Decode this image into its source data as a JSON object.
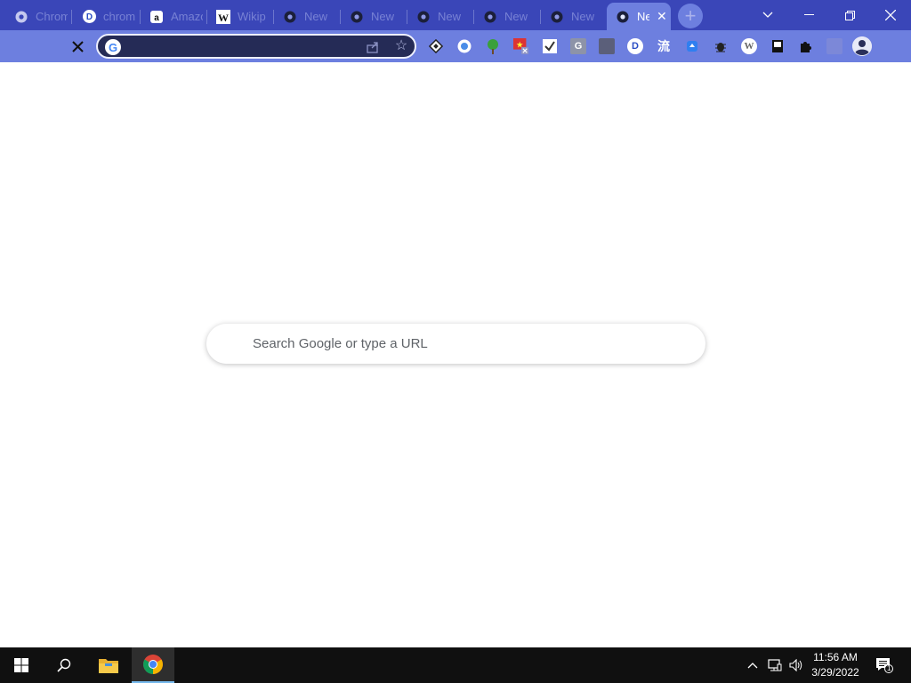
{
  "tabs": [
    {
      "title": "Chrom",
      "icon": "chrome-icon"
    },
    {
      "title": "chrom",
      "icon": "d-letter-icon"
    },
    {
      "title": "Amazo",
      "icon": "amazon-icon"
    },
    {
      "title": "Wikip",
      "icon": "wikipedia-icon"
    },
    {
      "title": "New",
      "icon": "chrome-icon"
    },
    {
      "title": "New",
      "icon": "chrome-icon"
    },
    {
      "title": "New",
      "icon": "chrome-icon"
    },
    {
      "title": "New",
      "icon": "chrome-icon"
    },
    {
      "title": "New",
      "icon": "chrome-icon"
    },
    {
      "title": "Ne",
      "icon": "chrome-icon",
      "active": true
    }
  ],
  "window_controls": {
    "tab_search": "tab-search-icon",
    "minimize": "minimize-icon",
    "restore": "restore-icon",
    "close": "close-icon"
  },
  "toolbar": {
    "omnibox_value": "",
    "extensions": [
      "ext-diamond",
      "ext-circle",
      "ext-tree",
      "ext-flag",
      "ext-check",
      "ext-g",
      "ext-gray",
      "ext-d",
      "ext-kanji",
      "ext-blue",
      "ext-bug",
      "ext-w",
      "ext-bookmark",
      "puzzle-icon",
      "ext-blank"
    ],
    "ext_g_label": "G",
    "ext_d_label": "D",
    "ext_kanji_label": "流",
    "ext_w_label": "W"
  },
  "content": {
    "search_placeholder": "Search Google or type a URL"
  },
  "taskbar": {
    "time": "11:56 AM",
    "date": "3/29/2022",
    "notification_count": "1"
  },
  "colors": {
    "tabstrip": "#3a46b8",
    "toolbar": "#6d7fdf",
    "omnibox": "#252b56",
    "taskbar": "#101010"
  }
}
